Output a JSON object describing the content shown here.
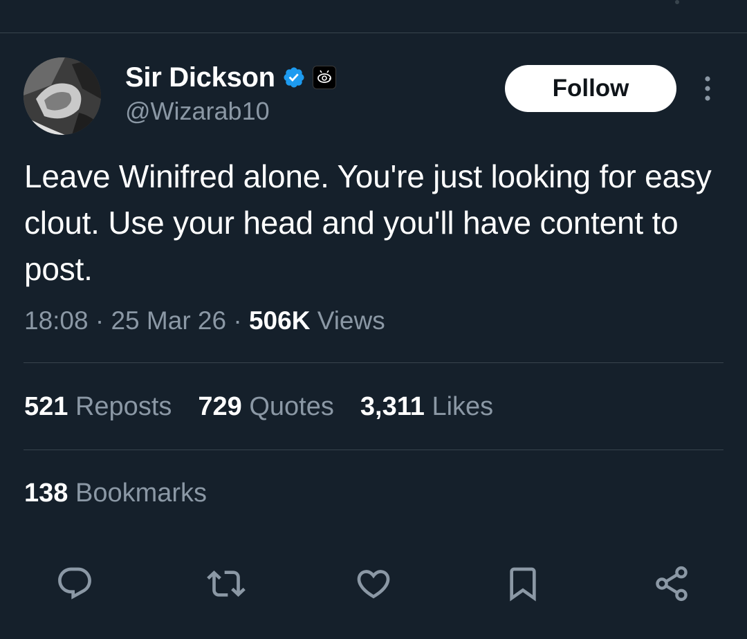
{
  "tweet": {
    "author": {
      "display_name": "Sir Dickson",
      "handle": "@Wizarab10",
      "verified_icon": "verified-badge-icon",
      "affiliate_icon": "affiliate-badge-icon"
    },
    "follow_label": "Follow",
    "text": "Leave Winifred alone. You're just looking for easy clout. Use your head and you'll have content to post.",
    "time": "18:08",
    "date": "25 Mar 26",
    "views_count": "506K",
    "views_label": "Views",
    "separator": "·"
  },
  "stats": [
    {
      "count": "521",
      "label": "Reposts"
    },
    {
      "count": "729",
      "label": "Quotes"
    },
    {
      "count": "3,311",
      "label": "Likes"
    }
  ],
  "bookmarks": {
    "count": "138",
    "label": "Bookmarks"
  },
  "actions": [
    "reply-icon",
    "repost-icon",
    "like-icon",
    "bookmark-icon",
    "share-icon"
  ],
  "colors": {
    "background": "#15202b",
    "text_primary": "#ffffff",
    "text_secondary": "#8b98a5",
    "divider": "#38444d",
    "verified_blue": "#1d9bf0",
    "follow_bg": "#ffffff",
    "follow_text": "#0f1419"
  }
}
